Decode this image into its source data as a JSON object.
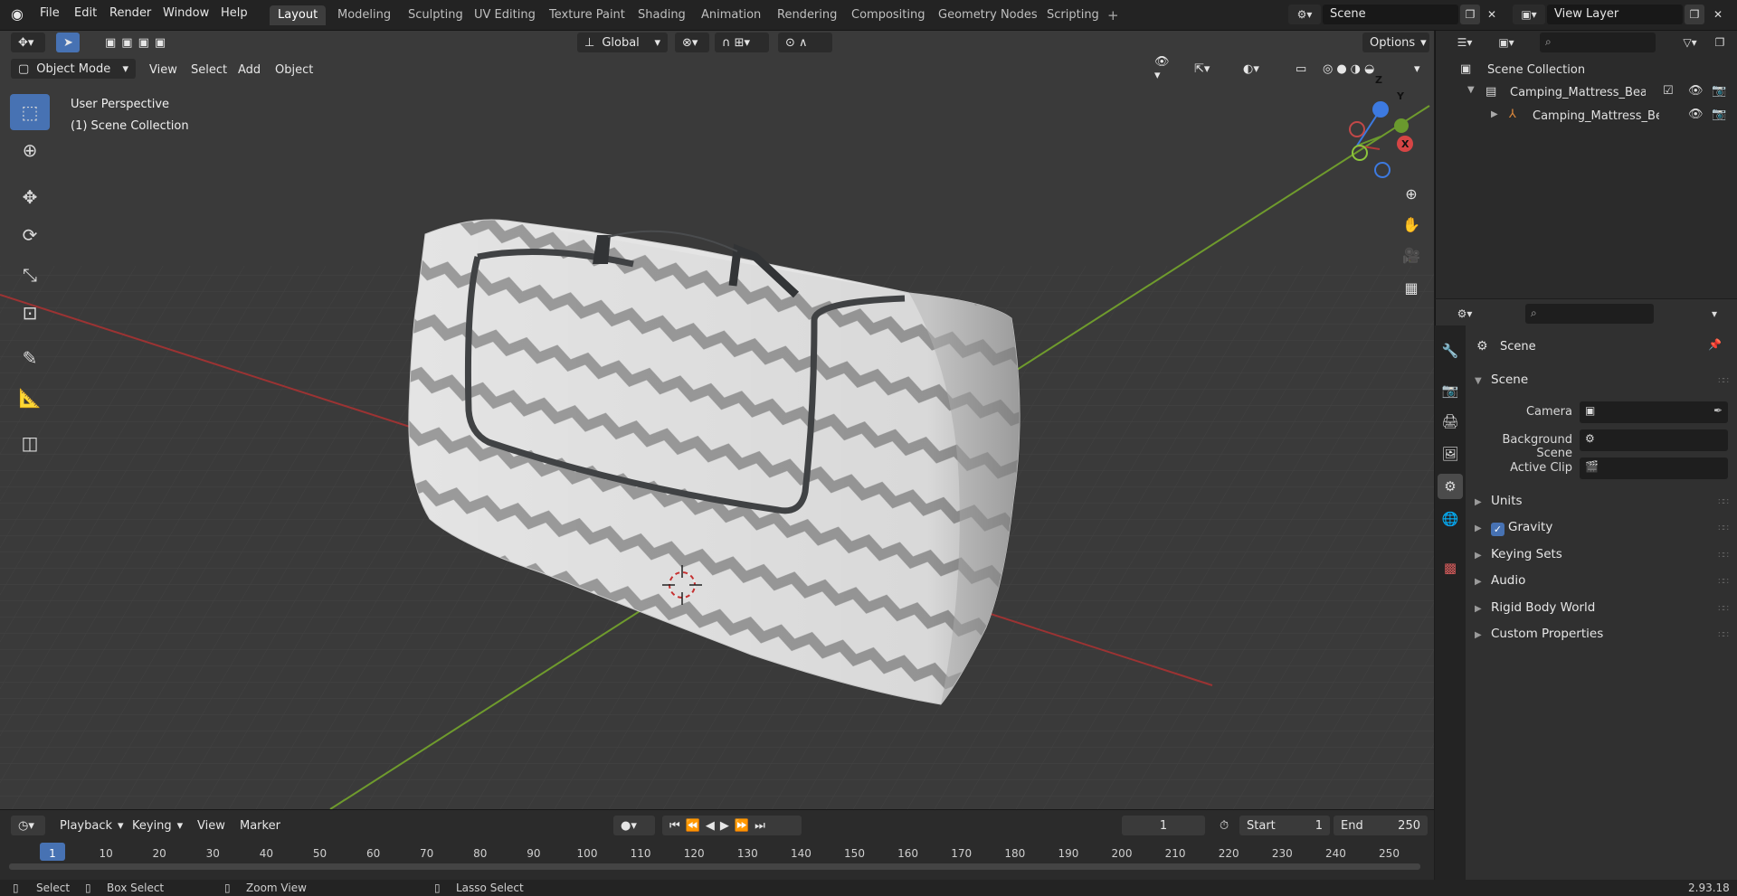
{
  "app": {
    "logo": "blender-logo-icon"
  },
  "menu": [
    "File",
    "Edit",
    "Render",
    "Window",
    "Help"
  ],
  "workspaces": [
    {
      "label": "Layout",
      "active": true
    },
    {
      "label": "Modeling"
    },
    {
      "label": "Sculpting"
    },
    {
      "label": "UV Editing"
    },
    {
      "label": "Texture Paint"
    },
    {
      "label": "Shading"
    },
    {
      "label": "Animation"
    },
    {
      "label": "Rendering"
    },
    {
      "label": "Compositing"
    },
    {
      "label": "Geometry Nodes"
    },
    {
      "label": "Scripting"
    }
  ],
  "scene_selector": {
    "value": "Scene"
  },
  "view_layer_selector": {
    "value": "View Layer"
  },
  "viewport": {
    "transform_orientation": "Global",
    "options_label": "Options",
    "mode": "Object Mode",
    "menus": [
      "View",
      "Select",
      "Add",
      "Object"
    ],
    "overlay_text": {
      "perspective": "User Perspective",
      "collection": "(1) Scene Collection"
    },
    "gizmo": {
      "z": "Z",
      "y": "Y",
      "x": "X"
    }
  },
  "timeline": {
    "menus": [
      "Playback",
      "Keying",
      "View",
      "Marker"
    ],
    "current_frame": "1",
    "start_label": "Start",
    "start_value": "1",
    "end_label": "End",
    "end_value": "250",
    "frame_ticks": [
      "1",
      "10",
      "20",
      "30",
      "40",
      "50",
      "60",
      "70",
      "80",
      "90",
      "100",
      "110",
      "120",
      "130",
      "140",
      "150",
      "160",
      "170",
      "180",
      "190",
      "200",
      "210",
      "220",
      "230",
      "240",
      "250"
    ]
  },
  "statusbar": {
    "select": "Select",
    "box_select": "Box Select",
    "zoom_view": "Zoom View",
    "lasso_select": "Lasso Select",
    "version": "2.93.18"
  },
  "outliner": {
    "root": "Scene Collection",
    "collection": "Camping_Mattress_Beach_Bla",
    "object": "Camping_Mattress_Beac"
  },
  "properties": {
    "context": "Scene",
    "panel_scene": "Scene",
    "camera_label": "Camera",
    "background_scene_label": "Background Scene",
    "active_clip_label": "Active Clip",
    "panels": [
      "Units",
      "Gravity",
      "Keying Sets",
      "Audio",
      "Rigid Body World",
      "Custom Properties"
    ],
    "gravity_checked": true
  },
  "colors": {
    "accent": "#4772b3",
    "x_axis": "#b33a3a",
    "y_axis": "#6a9a2e",
    "z_axis": "#3d7ae0"
  }
}
